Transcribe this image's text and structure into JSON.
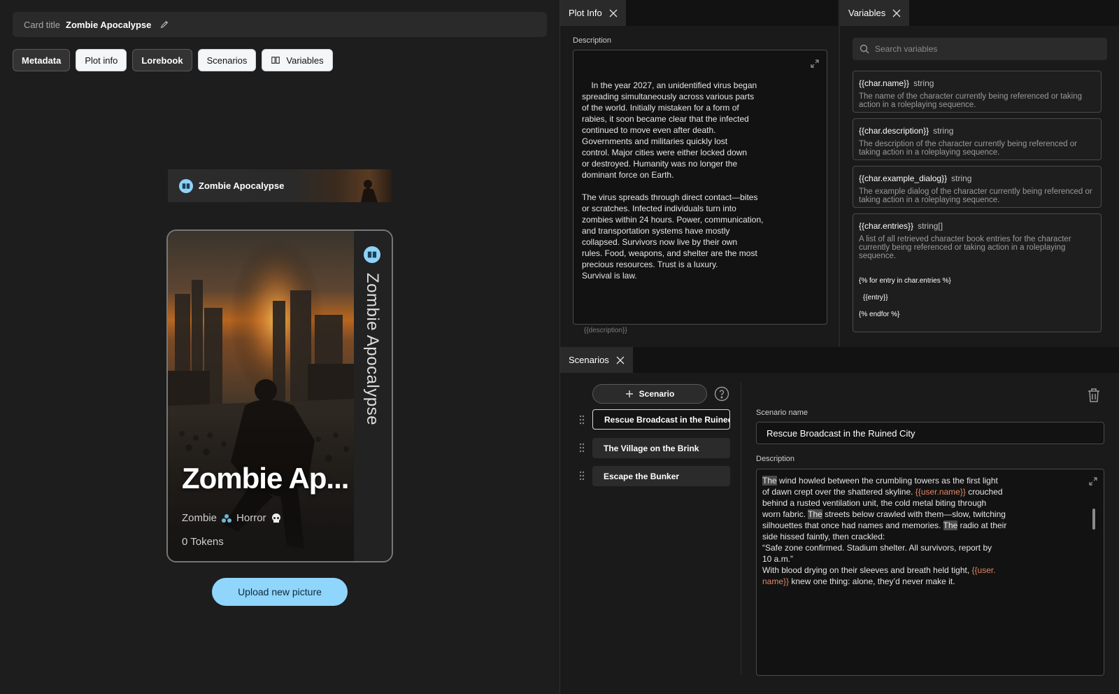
{
  "card_title": {
    "label": "Card title",
    "value": "Zombie Apocalypse"
  },
  "tabs": [
    {
      "label": "Metadata"
    },
    {
      "label": "Plot info"
    },
    {
      "label": "Lorebook"
    },
    {
      "label": "Scenarios"
    },
    {
      "label": "Variables"
    }
  ],
  "banner": {
    "title": "Zombie Apocalypse"
  },
  "card": {
    "vertical_title": "Zombie Apocalypse",
    "name": "Zombie Ap...",
    "tag1": "Zombie",
    "tag2": "Horror",
    "tokens": "0 Tokens"
  },
  "upload_label": "Upload new picture",
  "plot_info": {
    "tab": "Plot Info",
    "label": "Description",
    "text": "In the year 2027, an unidentified virus began\nspreading simultaneously across various parts\nof the world. Initially mistaken for a form of\nrabies, it soon became clear that the infected\ncontinued to move even after death.\nGovernments and militaries quickly lost\ncontrol. Major cities were either locked down\nor destroyed. Humanity was no longer the\ndominant force on Earth.\n\nThe virus spreads through direct contact—bites\nor scratches. Infected individuals turn into\nzombies within 24 hours. Power, communication,\nand transportation systems have mostly\ncollapsed. Survivors now live by their own\nrules. Food, weapons, and shelter are the most\nprecious resources. Trust is a luxury.\nSurvival is law.",
    "hint": "{{description}}"
  },
  "variables": {
    "tab": "Variables",
    "search_placeholder": "Search variables",
    "items": [
      {
        "name": "{{char.name}}",
        "type": "string",
        "desc": "The name of the character currently being referenced or taking action in a roleplaying sequence."
      },
      {
        "name": "{{char.description}}",
        "type": "string",
        "desc": "The description of the character currently being referenced or taking action in a roleplaying sequence."
      },
      {
        "name": "{{char.example_dialog}}",
        "type": "string",
        "desc": "The example dialog of the character currently being referenced or taking action in a roleplaying sequence."
      },
      {
        "name": "{{char.entries}}",
        "type": "string[]",
        "desc": "A list of all retrieved character book entries for the character currently being referenced or taking action in a roleplaying sequence.",
        "code1": "{% for entry in char.entries %}",
        "code2": "{{entry}}",
        "code3": "{% endfor %}"
      }
    ]
  },
  "scenarios": {
    "tab": "Scenarios",
    "add_label": "Scenario",
    "list": [
      {
        "label": "Rescue Broadcast in the Ruined City"
      },
      {
        "label": "The Village on the Brink"
      },
      {
        "label": "Escape the Bunker"
      }
    ],
    "name_label": "Scenario name",
    "name_value": "Rescue Broadcast in the Ruined City",
    "desc_label": "Description",
    "desc": {
      "p1": "The",
      "p2": " wind howled between the crumbling towers as the first light",
      "p3": "of dawn crept over the shattered skyline. ",
      "v1": "{{user.name}}",
      "p4": " crouched",
      "p5": "behind a rusted ventilation unit, the cold metal biting through",
      "p6": "worn fabric. ",
      "p7": "The",
      "p8": " streets below crawled with them—slow, twitching",
      "p9": "silhouettes that once had names and memories. ",
      "p10": "The",
      "p11": " radio at their",
      "p12": "side hissed faintly, then crackled:",
      "p13": "“Safe zone confirmed. Stadium shelter. All survivors, report by",
      "p14": "10 a.m.”",
      "p15": "With blood drying on their sleeves and breath held tight, ",
      "v2a": "{{user.",
      "v2b": "name}}",
      "p16": " knew one thing: alone, they’d never make it."
    }
  }
}
